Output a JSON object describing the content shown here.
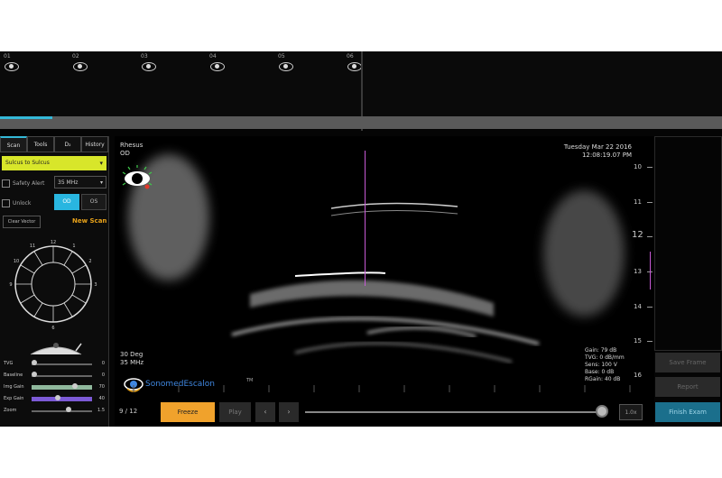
{
  "thumbnails": [
    {
      "label": "01"
    },
    {
      "label": "02"
    },
    {
      "label": "03"
    },
    {
      "label": "04"
    },
    {
      "label": "05"
    },
    {
      "label": "06"
    }
  ],
  "tabs": [
    "Scan",
    "Tools",
    "D₂",
    "History"
  ],
  "preset": {
    "value": "Sulcus to Sulcus"
  },
  "safety_alert": {
    "label": "Safety Alert",
    "checked": false
  },
  "frequency_select": {
    "value": "35 MHz"
  },
  "unlock": {
    "label": "Unlock"
  },
  "eye_buttons": {
    "od": "OD",
    "os": "OS",
    "selected": "OD"
  },
  "clear_vector": "Clear Vector",
  "new_scan": "New Scan",
  "clock": {
    "top": "12",
    "bottom": "6",
    "left": "9",
    "right": "3",
    "n1": "1",
    "n11": "11",
    "n2": "2",
    "n10": "10"
  },
  "sliders": [
    {
      "name": "TVG",
      "value": "0",
      "level": 0.0,
      "highlight": false
    },
    {
      "name": "Baseline",
      "value": "0",
      "level": 0.0,
      "highlight": false
    },
    {
      "name": "Img Gain",
      "value": "70",
      "level": 0.7,
      "highlight": true,
      "color": "#8fb89c"
    },
    {
      "name": "Exp Gain",
      "value": "40",
      "level": 0.4,
      "highlight": true,
      "color": "#7c5ad6"
    },
    {
      "name": "Zoom",
      "value": "1.5",
      "level": 0.6,
      "highlight": false
    }
  ],
  "image_overlay": {
    "patient": "Rhesus",
    "eye": "OD",
    "angle": "30 Deg",
    "frequency": "35 MHz",
    "date": "Tuesday Mar 22 2016",
    "time": "12:08:19.07 PM",
    "gain": "Gain: 79 dB",
    "tvg": "TVG: 0 dB/mm",
    "sens": "Sens: 100 V",
    "base": "Base: 0 dB",
    "rgain": "RGain: 40 dB"
  },
  "logo": {
    "brand": "SonomedEscalon",
    "tm": "TM"
  },
  "ruler": {
    "labels": [
      "10",
      "11",
      "12",
      "13",
      "14",
      "15",
      "16"
    ],
    "big_label": "12"
  },
  "side_buttons": {
    "save_frame": "Save Frame",
    "report": "Report",
    "finish_exam": "Finish Exam"
  },
  "playback": {
    "counter": "9 / 12",
    "freeze": "Freeze",
    "play": "Play",
    "prev": "‹",
    "next": "›",
    "speed": "1.0x",
    "position": 0.98
  },
  "colors": {
    "accent": "#34b9d8",
    "freeze": "#f0a22c",
    "preset": "#d8e62a",
    "new_scan": "#e8a21a",
    "cursor_line": "#c75ad6"
  }
}
